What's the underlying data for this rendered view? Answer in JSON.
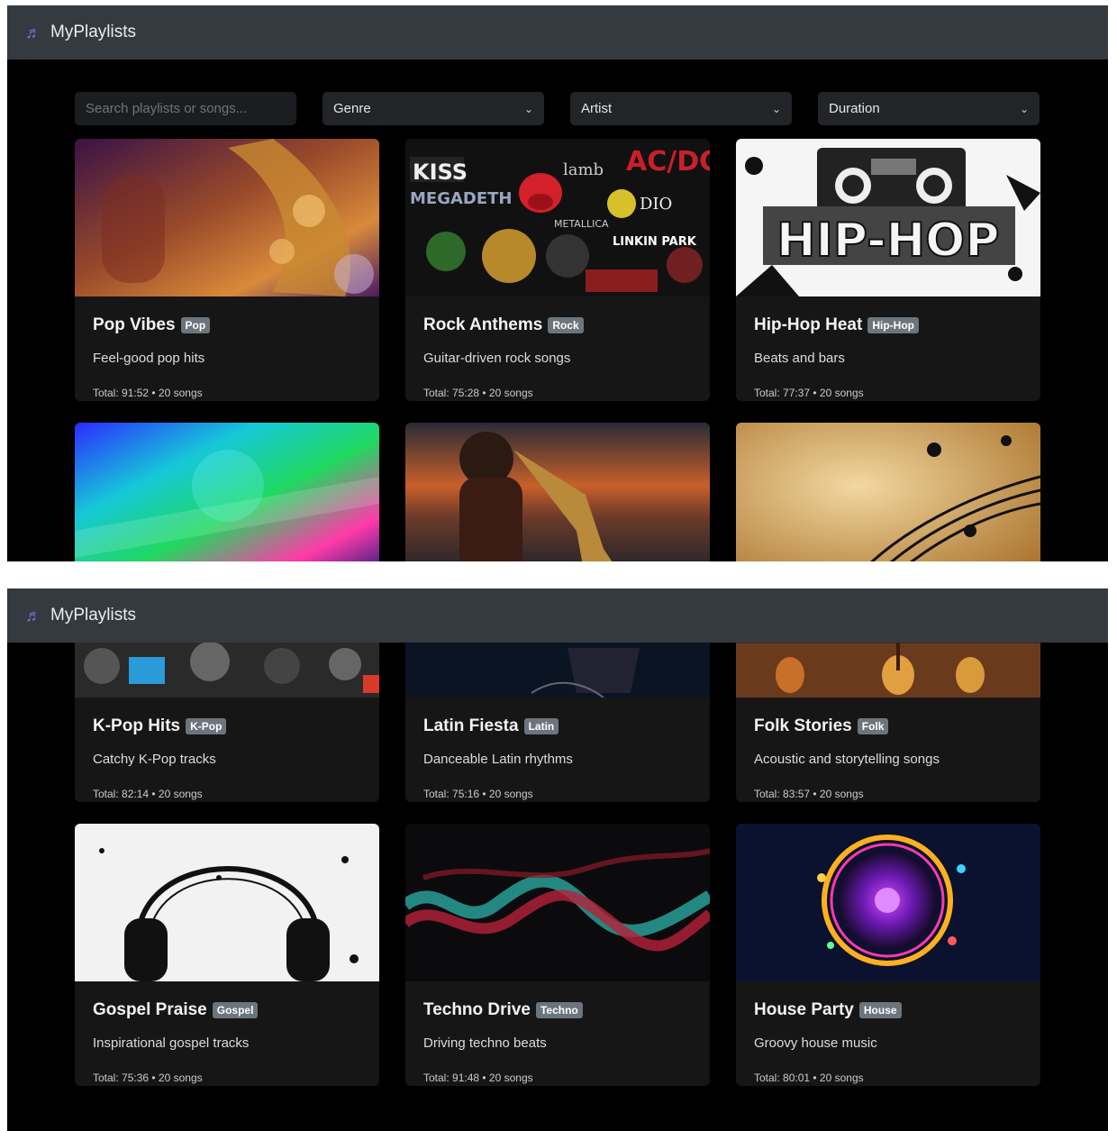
{
  "app": {
    "brand": "MyPlaylists"
  },
  "filters": {
    "search_placeholder": "Search playlists or songs...",
    "genre": "Genre",
    "artist": "Artist",
    "duration": "Duration"
  },
  "icons": {
    "brand": "music-note-icon",
    "dropdown": "chevron-down-icon"
  },
  "top_cards": [
    {
      "title": "Pop Vibes",
      "badge": "Pop",
      "desc": "Feel-good pop hits",
      "meta": "Total: 91:52 • 20 songs"
    },
    {
      "title": "Rock Anthems",
      "badge": "Rock",
      "desc": "Guitar-driven rock songs",
      "meta": "Total: 75:28 • 20 songs"
    },
    {
      "title": "Hip-Hop Heat",
      "badge": "Hip-Hop",
      "desc": "Beats and bars",
      "meta": "Total: 77:37 • 20 songs"
    }
  ],
  "bottom_cards": [
    {
      "title": "K-Pop Hits",
      "badge": "K-Pop",
      "desc": "Catchy K-Pop tracks",
      "meta": "Total: 82:14 • 20 songs"
    },
    {
      "title": "Latin Fiesta",
      "badge": "Latin",
      "desc": "Danceable Latin rhythms",
      "meta": "Total: 75:16 • 20 songs"
    },
    {
      "title": "Folk Stories",
      "badge": "Folk",
      "desc": "Acoustic and storytelling songs",
      "meta": "Total: 83:57 • 20 songs"
    },
    {
      "title": "Gospel Praise",
      "badge": "Gospel",
      "desc": "Inspirational gospel tracks",
      "meta": "Total: 75:36 • 20 songs"
    },
    {
      "title": "Techno Drive",
      "badge": "Techno",
      "desc": "Driving techno beats",
      "meta": "Total: 91:48 • 20 songs"
    },
    {
      "title": "House Party",
      "badge": "House",
      "desc": "Groovy house music",
      "meta": "Total: 80:01 • 20 songs"
    }
  ],
  "image_art": {
    "rock_logos": [
      "KISS",
      "AC/DC",
      "MEGADETH",
      "LINKIN PARK",
      "DIO",
      "METALLICA",
      "lamb"
    ],
    "hiphop_logo": "HIP-HOP"
  }
}
